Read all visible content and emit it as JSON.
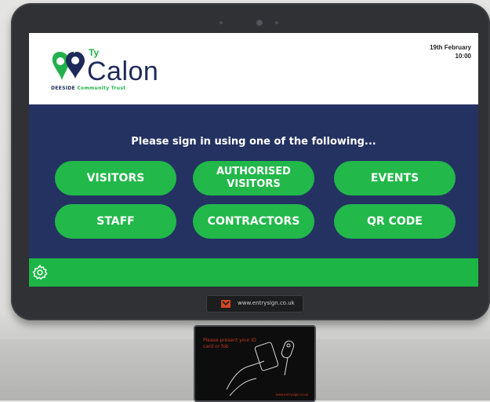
{
  "header": {
    "logo": {
      "ty": "Ty",
      "name": "Calon",
      "tagline_part1": "DEESIDE",
      "tagline_part2": "Community Trust"
    },
    "date": "19th February",
    "time": "10:00"
  },
  "main": {
    "prompt": "Please sign in using one of the following...",
    "buttons": [
      {
        "label": "VISITORS"
      },
      {
        "label": "AUTHORISED VISITORS"
      },
      {
        "label": "EVENTS"
      },
      {
        "label": "STAFF"
      },
      {
        "label": "CONTRACTORS"
      },
      {
        "label": "QR CODE"
      }
    ]
  },
  "footer": {
    "settings_icon": "gear-icon"
  },
  "hardware": {
    "brand_url": "www.entrysign.co.uk",
    "reader_text": "Please present your ID card or fob",
    "reader_url": "www.entrysign.co.uk"
  },
  "colors": {
    "navy": "#243262",
    "green": "#22b84a",
    "accent_text": "#c2391d"
  }
}
